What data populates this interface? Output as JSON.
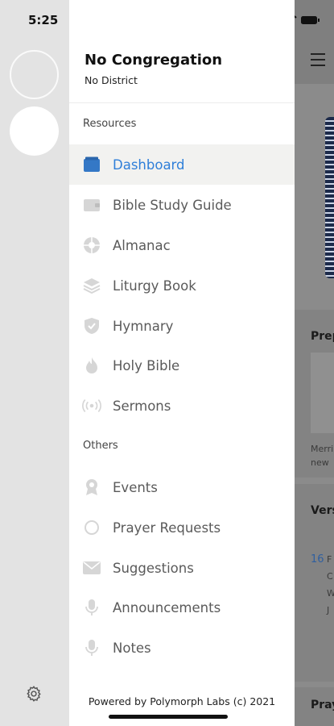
{
  "status_bar": {
    "time": "5:25"
  },
  "drawer": {
    "congregation": "No Congregation",
    "district": "No District",
    "resources_header": "Resources",
    "others_header": "Others",
    "resources": [
      {
        "label": "Dashboard",
        "icon": "dashboard-icon",
        "active": true
      },
      {
        "label": "Bible Study Guide",
        "icon": "wallet-icon"
      },
      {
        "label": "Almanac",
        "icon": "aperture-icon"
      },
      {
        "label": "Liturgy Book",
        "icon": "layers-icon"
      },
      {
        "label": "Hymnary",
        "icon": "shield-check-icon"
      },
      {
        "label": "Holy Bible",
        "icon": "bible-flame-icon"
      },
      {
        "label": "Sermons",
        "icon": "broadcast-icon"
      }
    ],
    "others": [
      {
        "label": "Events",
        "icon": "award-icon"
      },
      {
        "label": "Prayer Requests",
        "icon": "circle-outline-icon"
      },
      {
        "label": "Suggestions",
        "icon": "mail-icon"
      },
      {
        "label": "Announcements",
        "icon": "microphone-icon"
      },
      {
        "label": "Notes",
        "icon": "microphone-icon"
      }
    ],
    "footer": "Powered by Polymorph Labs (c) 2021"
  },
  "background": {
    "peek_prep": "Prep",
    "peek_merry": "Merri",
    "peek_new": "new",
    "peek_vers": "Vers",
    "verse_number": "16",
    "peek_f": "F",
    "peek_c": "C",
    "peek_w": "W",
    "peek_j": "J",
    "peek_pray": "Pray"
  },
  "colors": {
    "accent": "#2f7fd9",
    "active_bg": "#f2f2f0",
    "icon_gray": "#d4d4d4",
    "scrim": "#8b8b8b"
  }
}
